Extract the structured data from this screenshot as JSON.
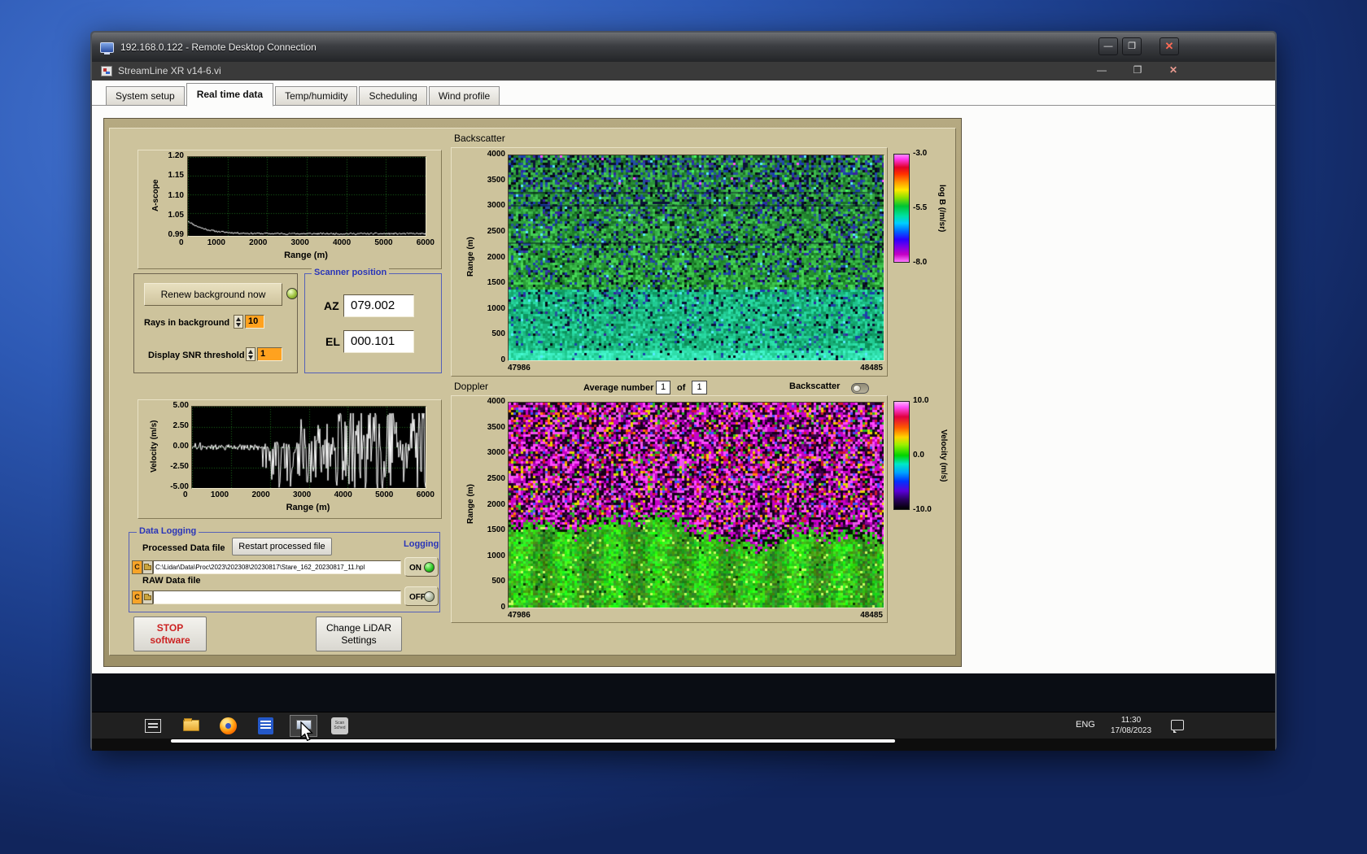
{
  "rdp": {
    "title": "192.168.0.122 - Remote Desktop Connection",
    "buttons": {
      "minimize": "—",
      "maximize": "❐",
      "close": "✕"
    }
  },
  "app": {
    "title": "StreamLine XR v14-6.vi",
    "window_buttons": {
      "minimize": "—",
      "restore": "❐",
      "close": "✕"
    },
    "tabs": [
      "System setup",
      "Real time data",
      "Temp/humidity",
      "Scheduling",
      "Wind profile"
    ],
    "active_tab": "Real time data"
  },
  "ascope": {
    "ylabel": "A-scope",
    "xlabel": "Range (m)",
    "yticks": [
      "1.20",
      "1.15",
      "1.10",
      "1.05",
      "0.99"
    ],
    "xticks": [
      "0",
      "1000",
      "2000",
      "3000",
      "4000",
      "5000",
      "6000"
    ]
  },
  "controls": {
    "renew_button": "Renew background now",
    "rays_label": "Rays in background",
    "rays_value": "10",
    "snr_label": "Display SNR threshold",
    "snr_value": "1"
  },
  "scanner": {
    "title": "Scanner position",
    "az_label": "AZ",
    "az_value": "079.002",
    "el_label": "EL",
    "el_value": "000.101"
  },
  "backscatter": {
    "title": "Backscatter",
    "ylabel": "Range (m)",
    "yticks": [
      "4000",
      "3500",
      "3000",
      "2500",
      "2000",
      "1500",
      "1000",
      "500",
      "0"
    ],
    "xticks": [
      "47986",
      "48485"
    ],
    "colorbar_ticks": [
      "-3.0",
      "-5.5",
      "-8.0"
    ],
    "colorbar_label": "log B (/m/sr)"
  },
  "average": {
    "label": "Average number",
    "value": "1",
    "of_label": "of",
    "total": "1",
    "toggle_label": "Backscatter"
  },
  "doppler": {
    "title": "Doppler",
    "ylabel": "Range (m)",
    "yticks": [
      "4000",
      "3500",
      "3000",
      "2500",
      "2000",
      "1500",
      "1000",
      "500",
      "0"
    ],
    "xticks": [
      "47986",
      "48485"
    ],
    "colorbar_ticks": [
      "10.0",
      "0.0",
      "-10.0"
    ],
    "colorbar_label": "Velocity (m/s)"
  },
  "velocity": {
    "ylabel": "Velocity (m/s)",
    "xlabel": "Range (m)",
    "yticks": [
      "5.00",
      "2.50",
      "0.00",
      "-2.50",
      "-5.00"
    ],
    "xticks": [
      "0",
      "1000",
      "2000",
      "3000",
      "4000",
      "5000",
      "6000"
    ]
  },
  "logging": {
    "title": "Data Logging",
    "processed_label": "Processed Data file",
    "restart_button": "Restart processed file",
    "processed_drive": "C",
    "processed_path": "C:\\Lidar\\Data\\Proc\\2023\\202308\\20230817\\Stare_162_20230817_11.hpl",
    "logging_label": "Logging",
    "on_label": "ON",
    "off_label": "OFF",
    "raw_label": "RAW Data file",
    "raw_drive": "C",
    "raw_path": ""
  },
  "buttons": {
    "stop_line1": "STOP",
    "stop_line2": "software",
    "change_line1": "Change LiDAR",
    "change_line2": "Settings"
  },
  "taskbar": {
    "language": "ENG",
    "time": "11:30",
    "date": "17/08/2023"
  },
  "chart_data": [
    {
      "type": "line",
      "title": "A-scope",
      "xlabel": "Range (m)",
      "ylabel": "A-scope",
      "xlim": [
        0,
        6000
      ],
      "ylim": [
        0.99,
        1.2
      ],
      "x": [
        0,
        200,
        400,
        600,
        800,
        1000,
        1500,
        2000,
        3000,
        4000,
        5000,
        6000
      ],
      "values": [
        1.03,
        1.021,
        1.013,
        1.008,
        1.004,
        1.001,
        0.998,
        0.996,
        0.996,
        0.995,
        0.996,
        0.995
      ],
      "note": "White noisy trace on black, green dotted grid; decays exponentially to ~0.996 baseline"
    },
    {
      "type": "heatmap",
      "title": "Backscatter",
      "ylabel": "Range (m)",
      "x_range": [
        47986,
        48485
      ],
      "y_range": [
        0,
        4000
      ],
      "colorbar": {
        "label": "log B (/m/sr)",
        "ticks": [
          -3.0,
          -5.5,
          -8.0
        ]
      },
      "description": "Speckled green backscatter field; fraction of dark blue/black speckles increases with range; teal-green band below ~1500 m; bright band near 0 m; faint dark horizontal lines near 2300, 3000 and 3300 m"
    },
    {
      "type": "line",
      "title": "Velocity",
      "xlabel": "Range (m)",
      "ylabel": "Velocity (m/s)",
      "xlim": [
        0,
        6000
      ],
      "ylim": [
        -5,
        5
      ],
      "x": [
        0,
        500,
        1000,
        1500,
        1800,
        2000,
        2200,
        2400,
        2600,
        3000,
        3400,
        3800,
        4200,
        4600,
        5000,
        5400,
        5800,
        6000
      ],
      "values": [
        0.1,
        -0.1,
        0.2,
        0.0,
        -0.2,
        -3.8,
        0.3,
        -4.5,
        -0.5,
        -4.8,
        2.1,
        -5.0,
        3.4,
        -4.6,
        2.8,
        -4.9,
        -1.2,
        3.0
      ],
      "note": "Near-zero up to ~1800 m, then dense aliased spikes spanning -5 to +4 m/s"
    },
    {
      "type": "heatmap",
      "title": "Doppler",
      "ylabel": "Range (m)",
      "x_range": [
        47986,
        48485
      ],
      "y_range": [
        0,
        4000
      ],
      "colorbar": {
        "label": "Velocity (m/s)",
        "ticks": [
          10.0,
          0.0,
          -10.0
        ]
      },
      "description": "Coherent bright-green (~0 m/s) layer from 0 up to a wavy boundary near 1400-1800 m; random magenta/purple/black noise with sparse red/yellow/green specks above"
    }
  ]
}
